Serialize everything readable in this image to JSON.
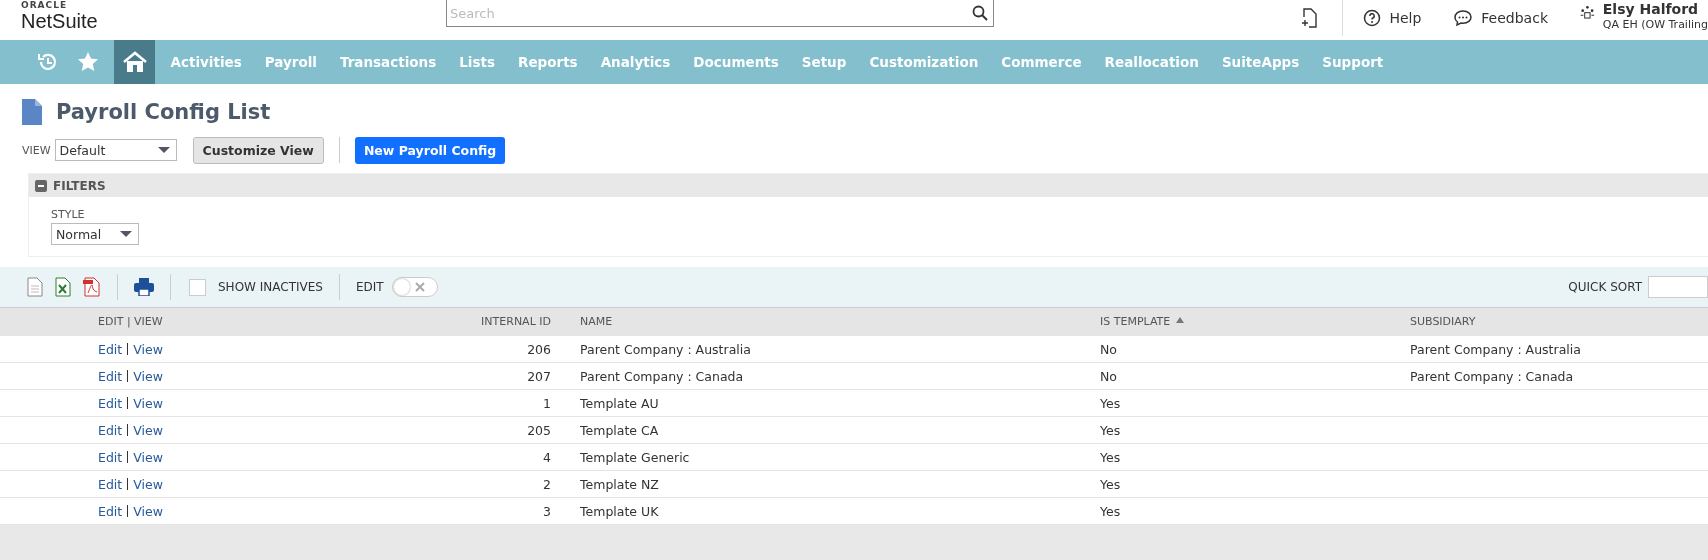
{
  "header": {
    "logo_top": "ORACLE",
    "logo": "NetSuite",
    "search": {
      "placeholder": "Search"
    },
    "help": "Help",
    "feedback": "Feedback",
    "user": {
      "name": "Elsy Halford",
      "role": "QA EH (OW Trailing"
    }
  },
  "nav": {
    "icons": [
      {
        "kind": "recent",
        "selected": false
      },
      {
        "kind": "star",
        "selected": false
      },
      {
        "kind": "home",
        "selected": true
      }
    ],
    "items": [
      {
        "label": "Activities",
        "selected": false
      },
      {
        "label": "Payroll",
        "selected": false
      },
      {
        "label": "Transactions",
        "selected": false
      },
      {
        "label": "Lists",
        "selected": false
      },
      {
        "label": "Reports",
        "selected": false
      },
      {
        "label": "Analytics",
        "selected": false
      },
      {
        "label": "Documents",
        "selected": false
      },
      {
        "label": "Setup",
        "selected": false
      },
      {
        "label": "Customization",
        "selected": false
      },
      {
        "label": "Commerce",
        "selected": false
      },
      {
        "label": "Reallocation",
        "selected": false
      },
      {
        "label": "SuiteApps",
        "selected": false
      },
      {
        "label": "Support",
        "selected": false
      }
    ]
  },
  "page": {
    "title": "Payroll Config List",
    "view_label": "VIEW",
    "view_value": "Default",
    "customize_button": "Customize View",
    "new_button": "New Payroll Config"
  },
  "filters": {
    "title": "FILTERS",
    "expanded": true,
    "style_label": "STYLE",
    "style_value": "Normal"
  },
  "toolbar": {
    "show_inactives": {
      "label": "SHOW INACTIVES",
      "checked": false
    },
    "edit": {
      "label": "EDIT",
      "on": false
    },
    "quick_sort": "QUICK SORT"
  },
  "table": {
    "columns": [
      {
        "label": "EDIT | VIEW",
        "sorted": false
      },
      {
        "label": "INTERNAL ID",
        "sorted": false
      },
      {
        "label": "NAME",
        "sorted": false
      },
      {
        "label": "IS TEMPLATE",
        "sorted": true
      },
      {
        "label": "SUBSIDIARY",
        "sorted": false
      }
    ],
    "rows": [
      {
        "edit": "Edit",
        "view": "View",
        "id": "206",
        "name": "Parent Company : Australia",
        "is_template": "No",
        "subsidiary": "Parent Company : Australia"
      },
      {
        "edit": "Edit",
        "view": "View",
        "id": "207",
        "name": "Parent Company : Canada",
        "is_template": "No",
        "subsidiary": "Parent Company : Canada"
      },
      {
        "edit": "Edit",
        "view": "View",
        "id": "1",
        "name": "Template AU",
        "is_template": "Yes"
      },
      {
        "edit": "Edit",
        "view": "View",
        "id": "205",
        "name": "Template CA",
        "is_template": "Yes"
      },
      {
        "edit": "Edit",
        "view": "View",
        "id": "4",
        "name": "Template Generic",
        "is_template": "Yes"
      },
      {
        "edit": "Edit",
        "view": "View",
        "id": "2",
        "name": "Template NZ",
        "is_template": "Yes"
      },
      {
        "edit": "Edit",
        "view": "View",
        "id": "3",
        "name": "Template UK",
        "is_template": "Yes"
      }
    ]
  }
}
